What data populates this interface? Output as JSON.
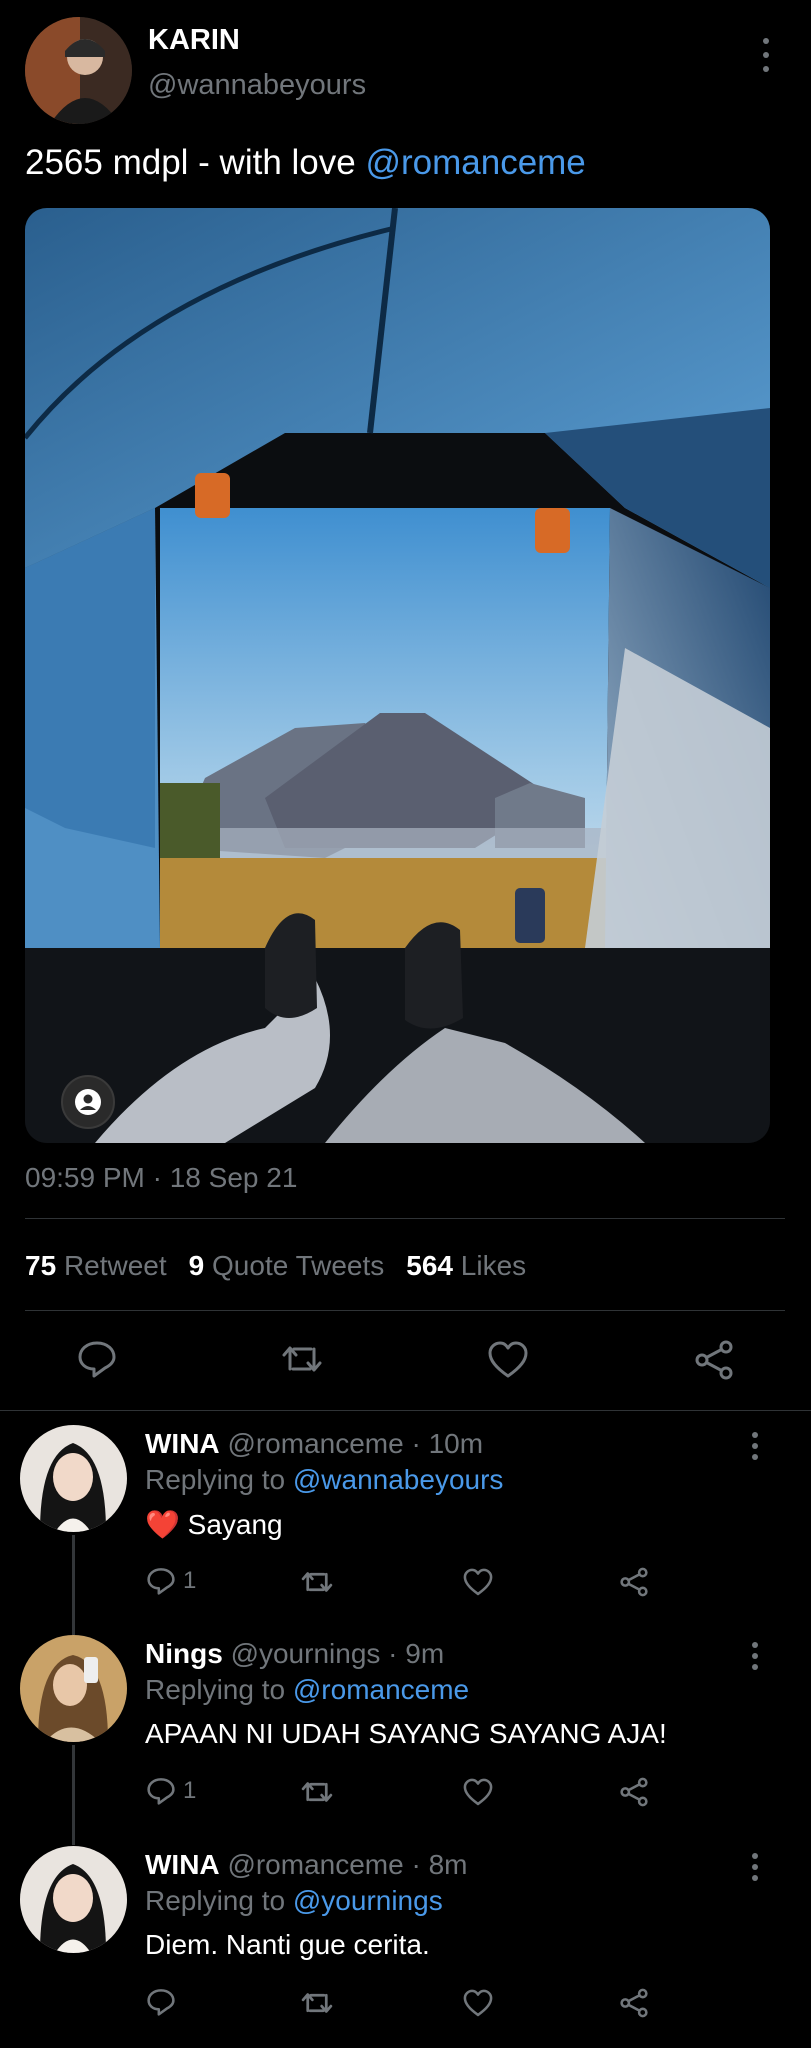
{
  "tweet": {
    "author_name": "KARIN",
    "author_handle": "@wannabeyours",
    "text_prefix": "2565 mdpl - with love ",
    "text_mention": "@romanceme",
    "timestamp": "09:59 PM · 18 Sep 21",
    "media_icon": "person-icon"
  },
  "stats": {
    "retweets_count": "75",
    "retweets_label": "Retweet",
    "quotes_count": "9",
    "quotes_label": "Quote Tweets",
    "likes_count": "564",
    "likes_label": "Likes"
  },
  "actions": [
    "reply-icon",
    "retweet-icon",
    "like-icon",
    "share-icon"
  ],
  "replies": [
    {
      "name": "WINA",
      "handle_time": "@romanceme · 10m",
      "replying_prefix": "Replying to ",
      "replying_to": "@wannabeyours",
      "emoji": "❤️",
      "text": "Sayang",
      "reply_count": "1"
    },
    {
      "name": "Nings",
      "handle_time": "@yournings · 9m",
      "replying_prefix": "Replying to ",
      "replying_to": "@romanceme",
      "text": "APAAN NI UDAH SAYANG SAYANG AJA!",
      "reply_count": "1"
    },
    {
      "name": "WINA",
      "handle_time": "@romanceme · 8m",
      "replying_prefix": "Replying to ",
      "replying_to": "@yournings",
      "text": "Diem. Nanti gue cerita.",
      "reply_count": ""
    }
  ],
  "colors": {
    "background": "#000000",
    "link": "#4a99e9",
    "muted": "#71767b",
    "heart": "#e0245e"
  }
}
